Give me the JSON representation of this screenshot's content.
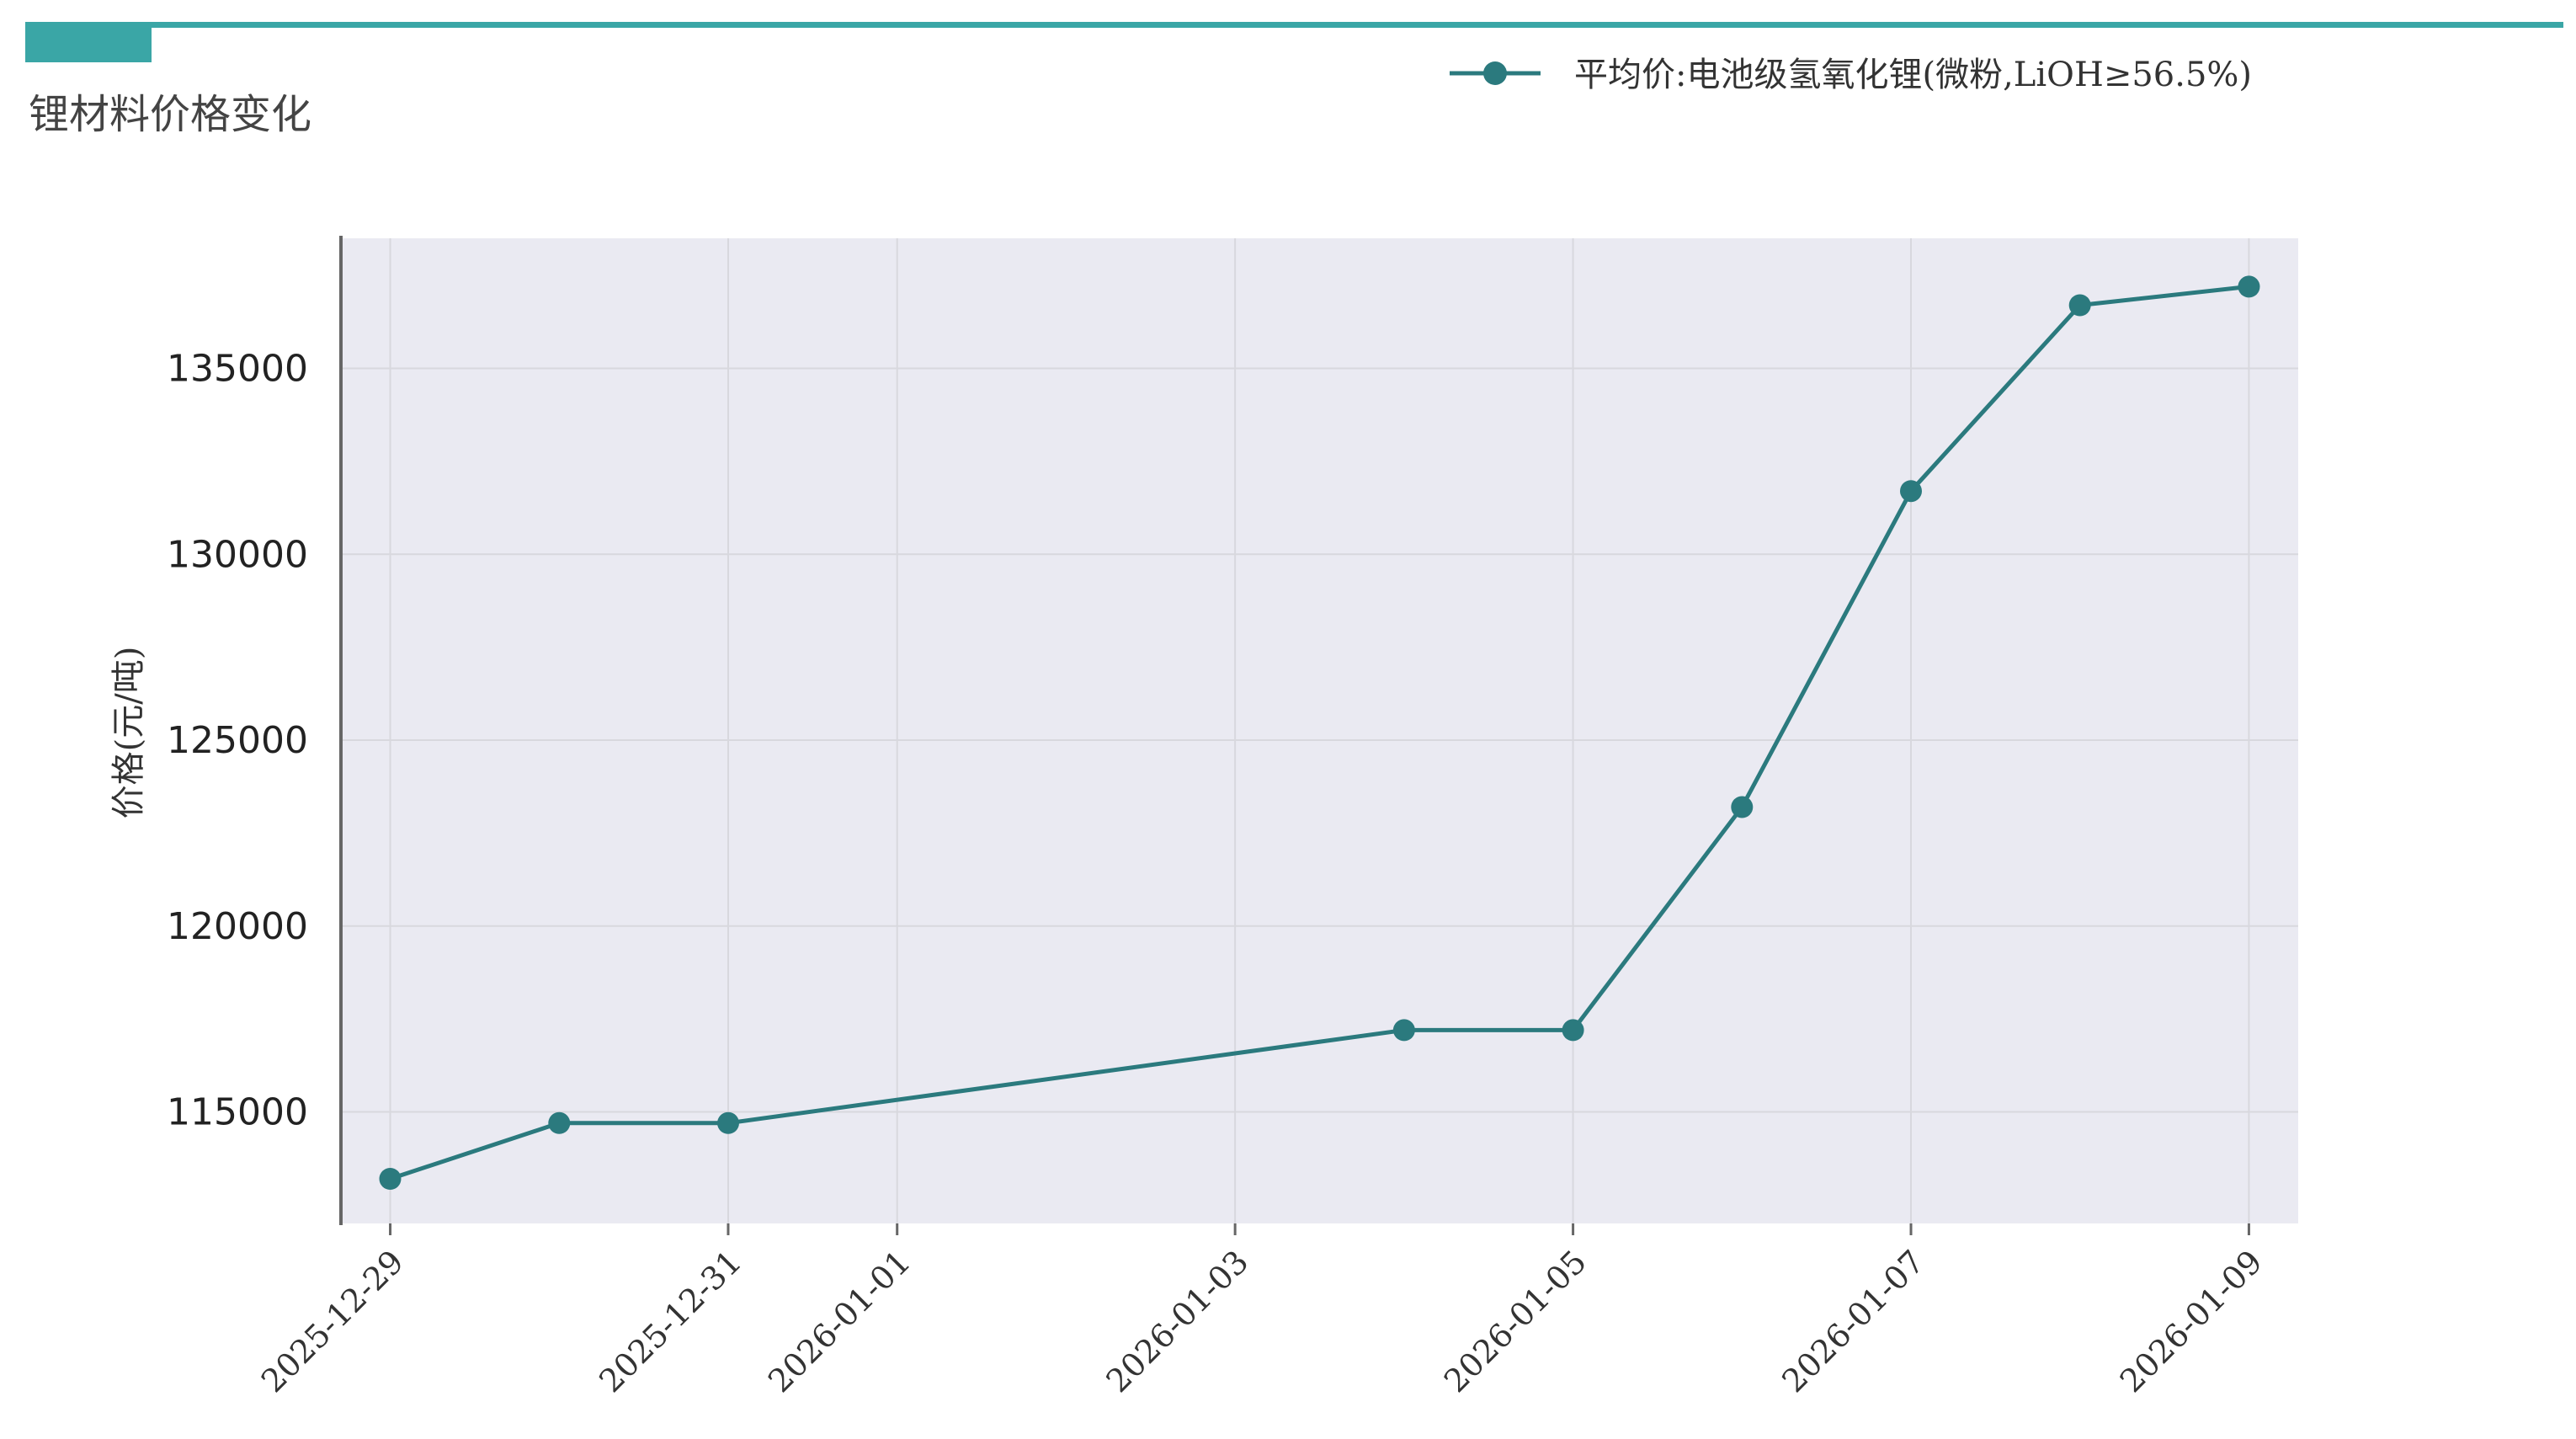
{
  "title": "锂材料价格变化",
  "colors": {
    "accent": "#3AA6A6",
    "series": "#2B7A7E",
    "plot_bg": "#EAEAF2",
    "grid": "#D8D8DE",
    "axis": "#666666"
  },
  "chart_data": {
    "type": "line",
    "title": "锂材料价格变化",
    "xlabel": "",
    "ylabel": "价格(元/吨)",
    "x_range": [
      "2025-12-28T17:00",
      "2026-01-09T07:00"
    ],
    "ylim": [
      112000,
      138500
    ],
    "yticks": [
      115000,
      120000,
      125000,
      130000,
      135000
    ],
    "xticks": [
      "2025-12-29",
      "2025-12-31",
      "2026-01-01",
      "2026-01-03",
      "2026-01-05",
      "2026-01-07",
      "2026-01-09"
    ],
    "grid": true,
    "legend_position": "top-right",
    "series": [
      {
        "name": "平均价:电池级氢氧化锂(微粉,LiOH≥56.5%)",
        "marker": "circle",
        "x": [
          "2025-12-29",
          "2025-12-30",
          "2025-12-31",
          "2026-01-04",
          "2026-01-05",
          "2026-01-06",
          "2026-01-07",
          "2026-01-08",
          "2026-01-09"
        ],
        "values": [
          113200,
          114700,
          114700,
          117200,
          117200,
          123200,
          131700,
          136700,
          137200
        ]
      }
    ]
  }
}
